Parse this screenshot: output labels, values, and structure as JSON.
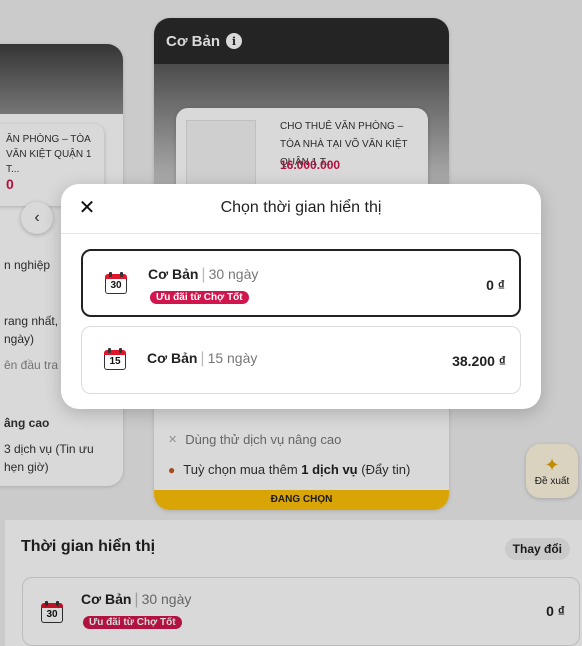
{
  "background": {
    "left_card": {
      "listing_title": "ĂN PHÒNG – TÒA\nVĂN KIỆT QUẬN 1 T...",
      "listing_price": "0",
      "line_1": "n nghiệp",
      "line_2": "rang nhất,\nngày)",
      "line_3": "ên đầu tra",
      "line_4": "âng cao",
      "line_5": "3 dịch vụ (Tin ưu\nhẹn giờ)"
    },
    "center_card": {
      "package_title": "Cơ Bản",
      "info_icon": "info-icon",
      "listing_title": "CHO THUÊ VĂN PHÒNG – TÒA NHÀ TẠI VÕ VĂN KIỆT QUẬN 1 T...",
      "listing_price": "16.000.000",
      "feature_trial": "Dùng thử dịch vụ nâng cao",
      "feature_buy_pre": "Tuỳ chọn mua thêm ",
      "feature_buy_bold": "1 dịch vụ",
      "feature_buy_post": " (Đẩy tin)",
      "selected_label": "ĐANG CHỌN"
    },
    "suggest_button": "Đề xuất",
    "bottom_section": {
      "title": "Thời gian hiển thị",
      "change_label": "Thay đổi",
      "selected_option": {
        "name": "Cơ Bản",
        "days": "30 ngày",
        "badge": "Ưu đãi từ Chợ Tốt",
        "price": "0 ₫",
        "calendar_number": "30"
      }
    }
  },
  "modal": {
    "title": "Chọn thời gian hiển thị",
    "close_icon": "close-icon",
    "options": [
      {
        "name": "Cơ Bản",
        "days": "15 ngày",
        "badge": "",
        "price": "38.200 ₫",
        "calendar_number": "15",
        "selected": false
      },
      {
        "name": "Cơ Bản",
        "days": "30 ngày",
        "badge": "Ưu đãi từ Chợ Tốt",
        "price": "0 ₫",
        "calendar_number": "30",
        "selected": true
      }
    ]
  },
  "colors": {
    "accent_red": "#d0164c",
    "calendar_red": "#e0162b",
    "selected_bar": "#ffc107"
  }
}
